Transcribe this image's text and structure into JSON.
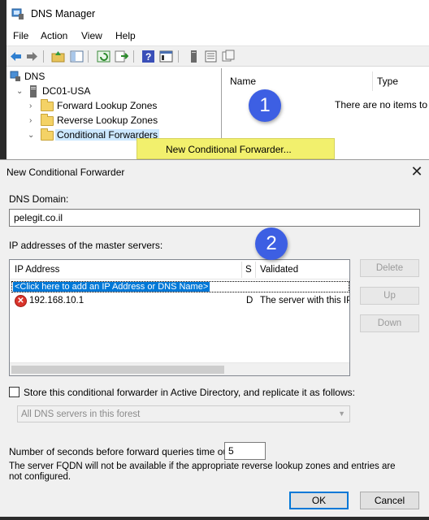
{
  "dns_manager": {
    "title": "DNS Manager",
    "menu": [
      "File",
      "Action",
      "View",
      "Help"
    ],
    "tree": {
      "root": "DNS",
      "server": "DC01-USA",
      "items": [
        "Forward Lookup Zones",
        "Reverse Lookup Zones",
        "Conditional Forwarders"
      ]
    },
    "list": {
      "col_name": "Name",
      "col_type": "Type",
      "empty_text": "There are no items to s"
    },
    "context_menu_item": "New Conditional Forwarder..."
  },
  "annotations": {
    "step1": "1",
    "step2": "2"
  },
  "dialog": {
    "title": "New Conditional Forwarder",
    "close": "✕",
    "dns_domain_label": "DNS Domain:",
    "dns_domain_value": "pelegit.co.il",
    "ip_label": "IP addresses of the master servers:",
    "columns": {
      "ip": "IP Address",
      "s": "S",
      "validated": "Validated"
    },
    "add_row": "<Click here to add an IP Address or DNS Name>",
    "rows": [
      {
        "ip": "192.168.10.1",
        "s": "D",
        "validated": "The server with this IP"
      }
    ],
    "buttons": {
      "delete": "Delete",
      "up": "Up",
      "down": "Down",
      "ok": "OK",
      "cancel": "Cancel"
    },
    "store_label": "Store this conditional forwarder in Active Directory, and replicate it as follows:",
    "store_checked": false,
    "replication_value": "All DNS servers in this forest",
    "timeout_label": "Number of seconds before forward queries time out:",
    "timeout_value": "5",
    "note": "The server FQDN will not be available if the appropriate reverse lookup zones and entries are not configured."
  },
  "colors": {
    "accent": "#0078d7",
    "badge": "#3d5fe3",
    "highlight": "#f2f06d",
    "error": "#d9342b"
  }
}
